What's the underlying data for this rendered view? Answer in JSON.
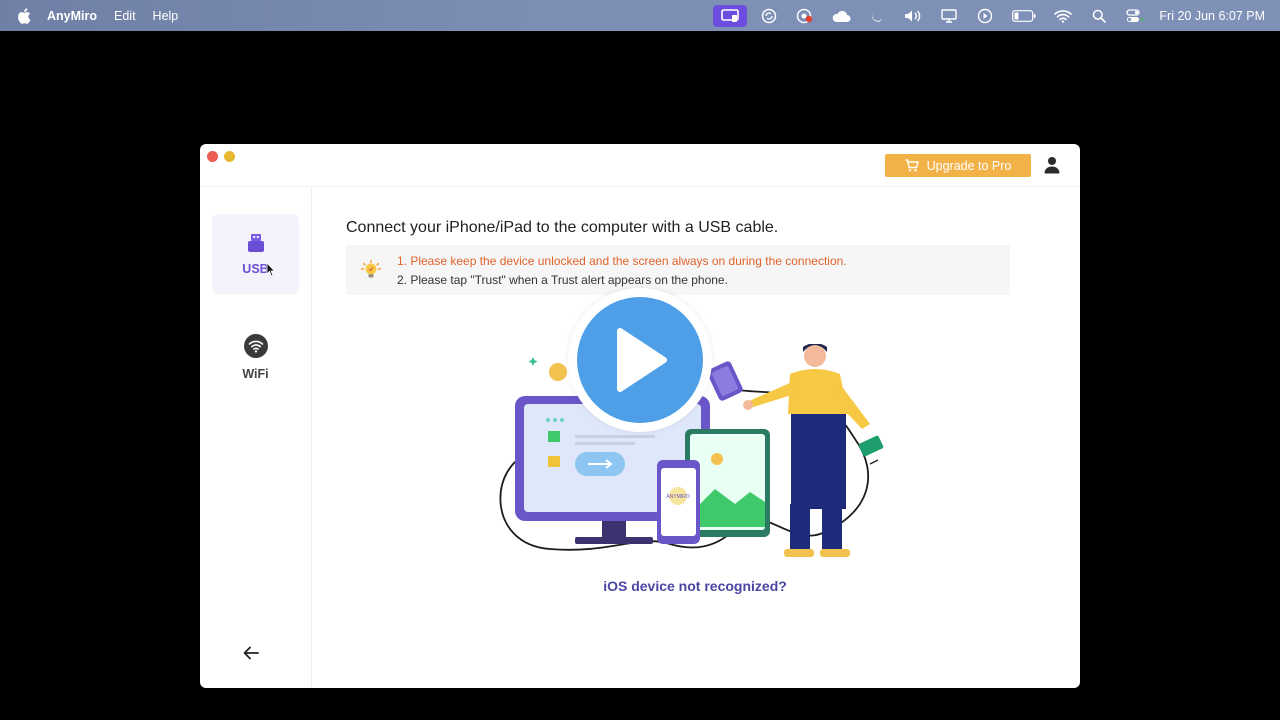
{
  "menubar": {
    "app_name": "AnyMiro",
    "menu_items": [
      "Edit",
      "Help"
    ],
    "clock": "Fri 20 Jun  6:07 PM",
    "status_icons": [
      "screen-mirror-icon",
      "sync-icon",
      "record-icon",
      "cloud-icon",
      "moon-icon",
      "volume-icon",
      "display-icon",
      "play-circle-icon",
      "battery-icon",
      "wifi-icon",
      "search-icon",
      "control-center-icon"
    ]
  },
  "window": {
    "upgrade_label": "Upgrade to Pro"
  },
  "sidebar": {
    "items": [
      {
        "label": "USB",
        "icon": "usb-icon",
        "selected": true
      },
      {
        "label": "WiFi",
        "icon": "wifi-icon",
        "selected": false
      }
    ]
  },
  "main": {
    "title": "Connect your iPhone/iPad to the computer with a USB cable.",
    "tips": [
      "1. Please keep the device unlocked and the screen always on during the connection.",
      "2. Please tap \"Trust\" when a Trust alert appears on the phone."
    ],
    "illustration_texts": [
      "ANYMIRO"
    ],
    "ios_link": "iOS device not recognized?"
  },
  "colors": {
    "accent": "#6a4fd6",
    "upgrade": "#f2b248",
    "tip_warning": "#e0632a",
    "link": "#4a47a3",
    "play": "#4f9fe8"
  }
}
